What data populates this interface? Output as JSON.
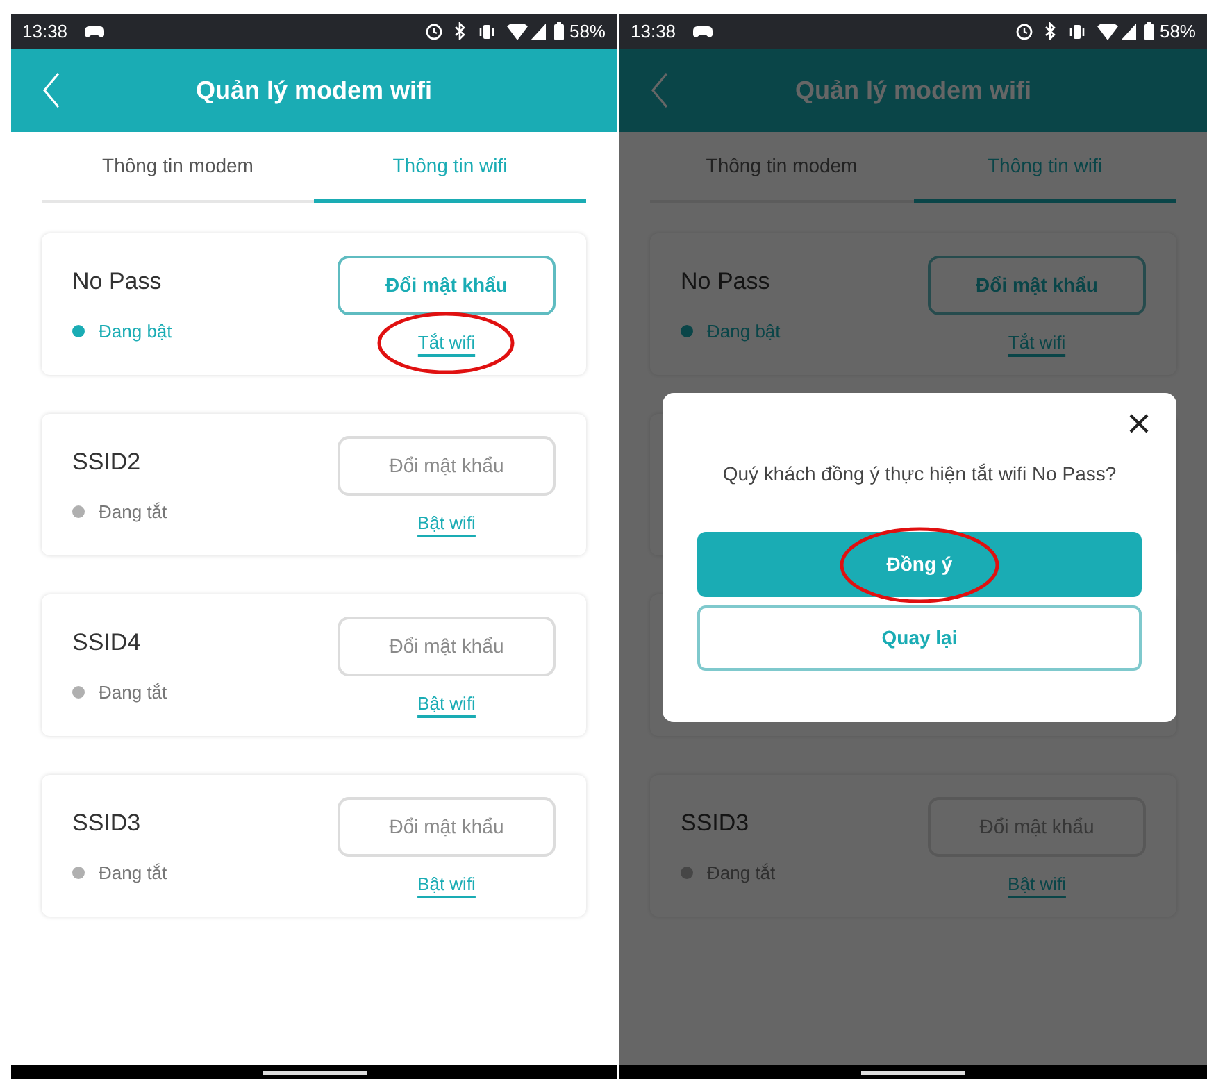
{
  "screens": [
    {
      "status_bar": {
        "time": "13:38",
        "battery": "58%"
      },
      "header": {
        "title": "Quản lý modem wifi"
      },
      "tabs": [
        {
          "label": "Thông tin modem",
          "selected": false
        },
        {
          "label": "Thông tin wifi",
          "selected": true
        }
      ],
      "networks": [
        {
          "kind": "card",
          "name": "No Pass",
          "on": true,
          "status": "Đang bật",
          "button": "Đổi mật khẩu",
          "toggle": "Tắt wifi",
          "circled": true
        },
        {
          "kind": "card",
          "name": "SSID2",
          "on": false,
          "status": "Đang tắt",
          "button": "Đổi mật khẩu",
          "toggle": "Bật wifi",
          "circled": false
        },
        {
          "kind": "card",
          "name": "SSID4",
          "on": false,
          "status": "Đang tắt",
          "button": "Đổi mật khẩu",
          "toggle": "Bật wifi",
          "circled": false
        },
        {
          "kind": "card",
          "name": "SSID3",
          "on": false,
          "status": "Đang tắt",
          "button": "Đổi mật khẩu",
          "toggle": "Bật wifi",
          "circled": false
        }
      ]
    },
    {
      "status_bar": {
        "time": "13:38",
        "battery": "58%"
      },
      "header": {
        "title": "Quản lý modem wifi"
      },
      "tabs": [
        {
          "label": "Thông tin modem",
          "selected": false
        },
        {
          "label": "Thông tin wifi",
          "selected": true
        }
      ],
      "networks": [
        {
          "kind": "card",
          "name": "No Pass",
          "on": true,
          "status": "Đang bật",
          "button": "Đổi mật khẩu",
          "toggle": "Tắt wifi",
          "circled": false
        },
        {
          "kind": "covered"
        },
        {
          "kind": "covered"
        },
        {
          "kind": "card",
          "name": "SSID3",
          "on": false,
          "status": "Đang tắt",
          "button": "Đổi mật khẩu",
          "toggle": "Bật wifi",
          "circled": false
        }
      ],
      "dialog": {
        "message": "Quý khách đồng ý thực hiện tắt wifi No Pass?",
        "confirm": {
          "label": "Đồng ý",
          "circled": true
        },
        "cancel": {
          "label": "Quay lại",
          "circled": false
        }
      }
    }
  ]
}
